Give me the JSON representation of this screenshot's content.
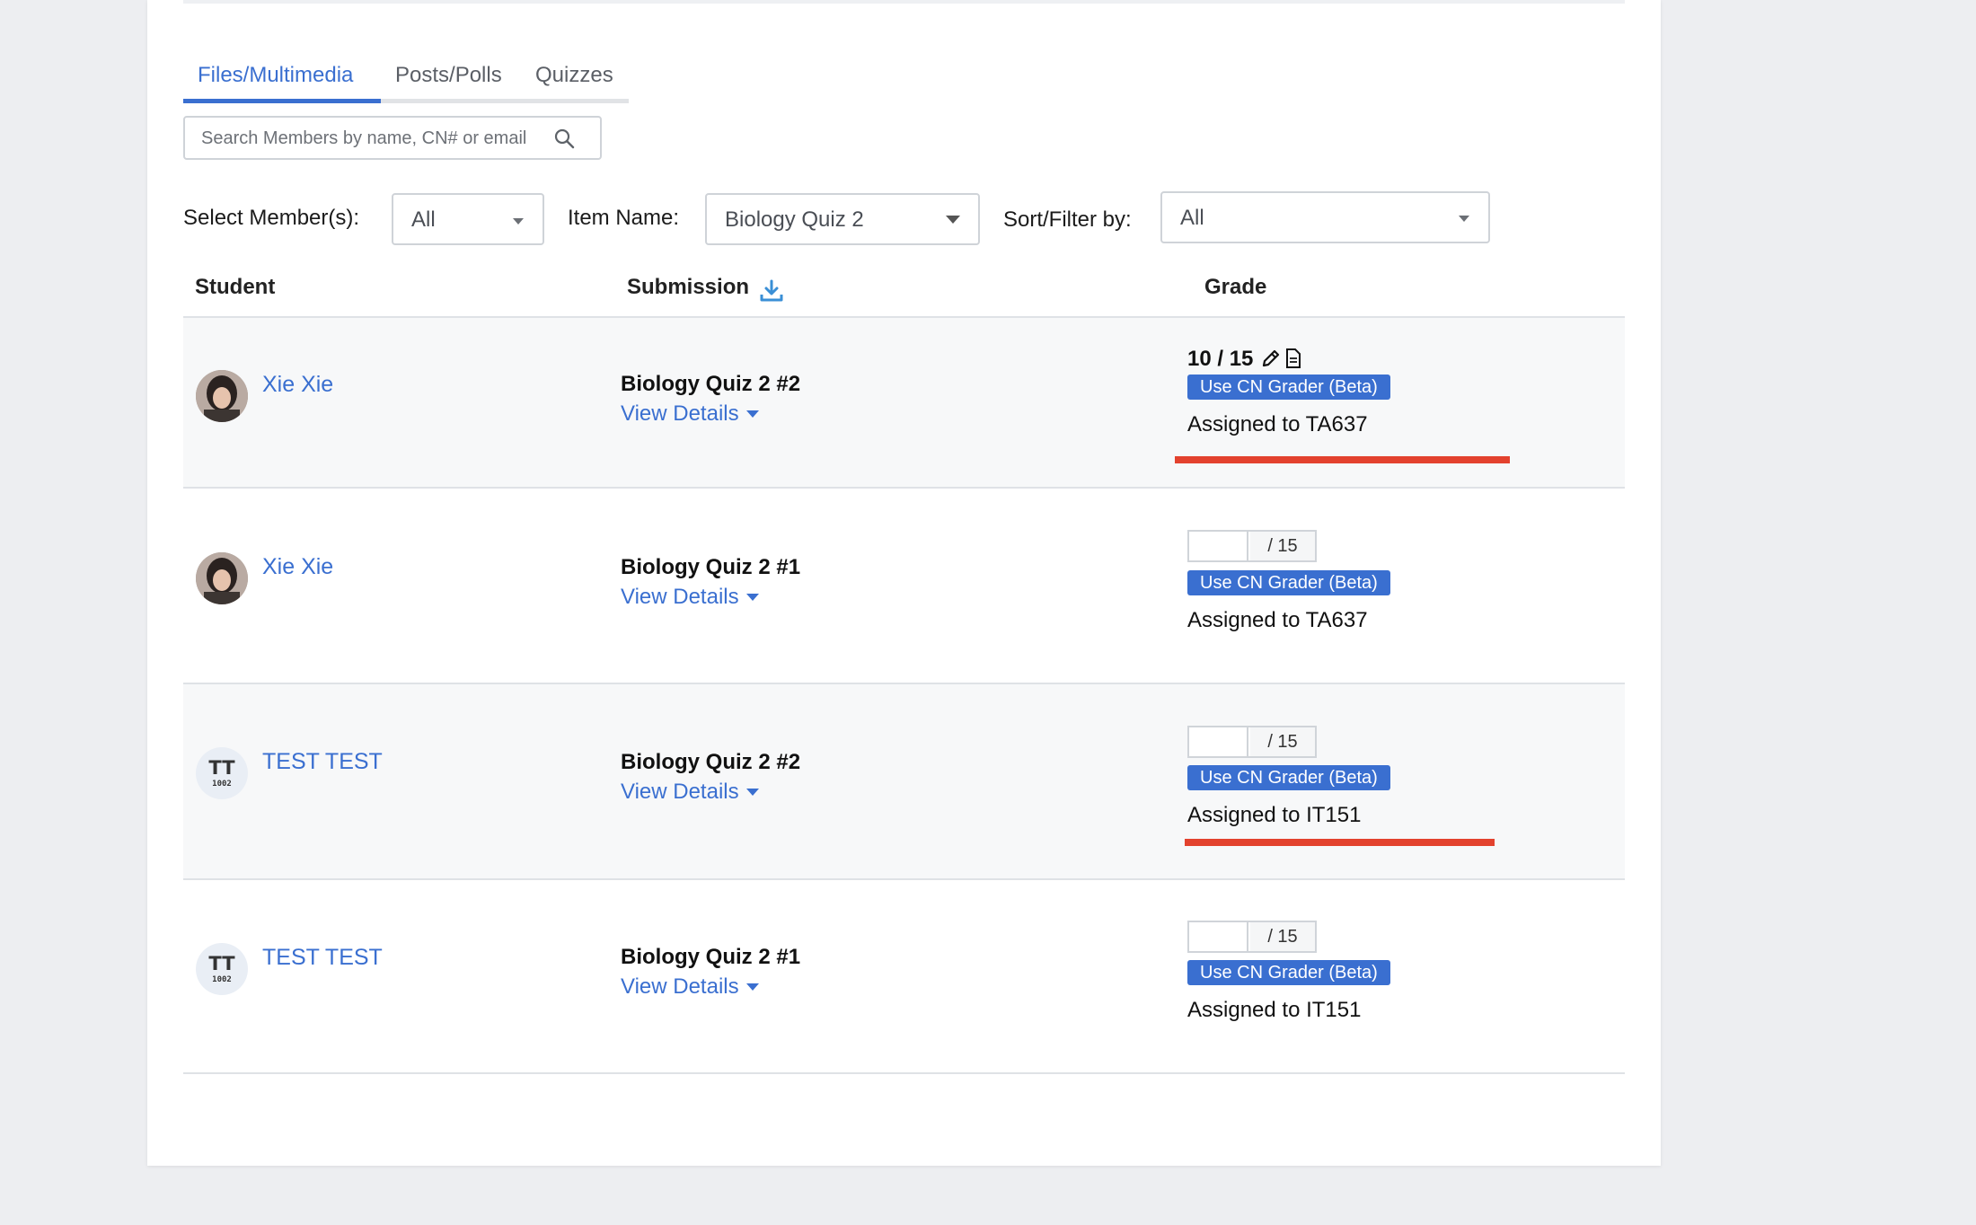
{
  "tabs": [
    {
      "label": "Files/Multimedia",
      "active": true
    },
    {
      "label": "Posts/Polls",
      "active": false
    },
    {
      "label": "Quizzes",
      "active": false
    }
  ],
  "search": {
    "placeholder": "Search Members by name, CN# or email"
  },
  "filters": {
    "member_label": "Select Member(s):",
    "member_value": "All",
    "item_label": "Item Name:",
    "item_value": "Biology Quiz 2",
    "sort_label": "Sort/Filter by:",
    "sort_value": "All"
  },
  "table": {
    "headers": {
      "student": "Student",
      "submission": "Submission",
      "grade": "Grade"
    },
    "rows": [
      {
        "student": "Xie Xie",
        "avatar": "photo",
        "submission": "Biology Quiz 2 #2",
        "details": "View Details",
        "grade": "10 / 15",
        "grade_max": "/ 15",
        "grader_button": "Use CN Grader (Beta)",
        "assigned": "Assigned to TA637",
        "highlighted": true
      },
      {
        "student": "Xie Xie",
        "avatar": "photo",
        "submission": "Biology Quiz 2 #1",
        "details": "View Details",
        "grade": "",
        "grade_max": "/ 15",
        "grader_button": "Use CN Grader (Beta)",
        "assigned": "Assigned to TA637",
        "highlighted": false
      },
      {
        "student": "TEST TEST",
        "avatar": "initials",
        "initials": "TT",
        "avatar_number": "1002",
        "submission": "Biology Quiz 2 #2",
        "details": "View Details",
        "grade": "",
        "grade_max": "/ 15",
        "grader_button": "Use CN Grader (Beta)",
        "assigned": "Assigned to IT151",
        "highlighted": true
      },
      {
        "student": "TEST TEST",
        "avatar": "initials",
        "initials": "TT",
        "avatar_number": "1002",
        "submission": "Biology Quiz 2 #1",
        "details": "View Details",
        "grade": "",
        "grade_max": "/ 15",
        "grader_button": "Use CN Grader (Beta)",
        "assigned": "Assigned to IT151",
        "highlighted": false
      }
    ]
  },
  "colors": {
    "accent": "#3a6fd0",
    "highlight": "#e3422e",
    "background": "#edeef1"
  }
}
